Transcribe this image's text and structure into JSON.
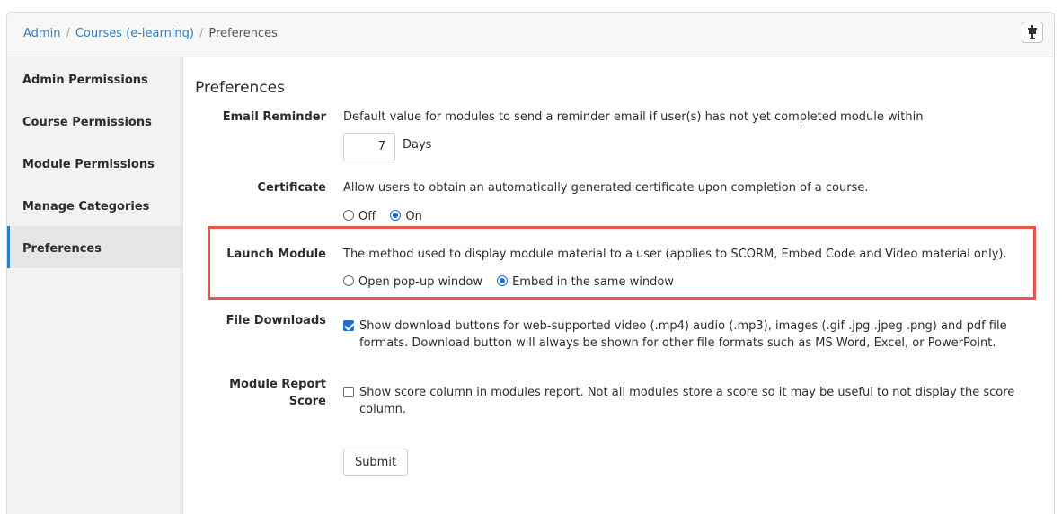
{
  "breadcrumb": {
    "items": [
      "Admin",
      "Courses (e-learning)"
    ],
    "separator": "/",
    "current": "Preferences"
  },
  "topbar": {
    "pin_icon": "presentation-pin-icon"
  },
  "sidebar": {
    "items": [
      {
        "label": "Admin Permissions"
      },
      {
        "label": "Course Permissions"
      },
      {
        "label": "Module Permissions"
      },
      {
        "label": "Manage Categories"
      },
      {
        "label": "Preferences",
        "active": true
      }
    ]
  },
  "main": {
    "title": "Preferences",
    "email_reminder": {
      "label": "Email Reminder",
      "description": "Default value for modules to send a reminder email if user(s) has not yet completed module within",
      "value": "7",
      "unit": "Days"
    },
    "certificate": {
      "label": "Certificate",
      "description": "Allow users to obtain an automatically generated certificate upon completion of a course.",
      "options": [
        "Off",
        "On"
      ],
      "selected": "On"
    },
    "launch_module": {
      "label": "Launch Module",
      "description": "The method used to display module material to a user (applies to SCORM, Embed Code and Video material only).",
      "options": [
        "Open pop-up window",
        "Embed in the same window"
      ],
      "selected": "Embed in the same window",
      "highlight_color": "#e8574c"
    },
    "file_downloads": {
      "label": "File Downloads",
      "checked": true,
      "text": "Show download buttons for web-supported video (.mp4) audio (.mp3), images (.gif .jpg .jpeg .png) and pdf file formats. Download button will always be shown for other file formats such as MS Word, Excel, or PowerPoint."
    },
    "module_report_score": {
      "label_line1": "Module Report",
      "label_line2": "Score",
      "checked": false,
      "text": "Show score column in modules report. Not all modules store a score so it may be useful to not display the score column."
    },
    "submit_label": "Submit"
  },
  "colors": {
    "link": "#2f7fc4",
    "accent": "#1b6fd6",
    "highlight": "#e8574c"
  }
}
